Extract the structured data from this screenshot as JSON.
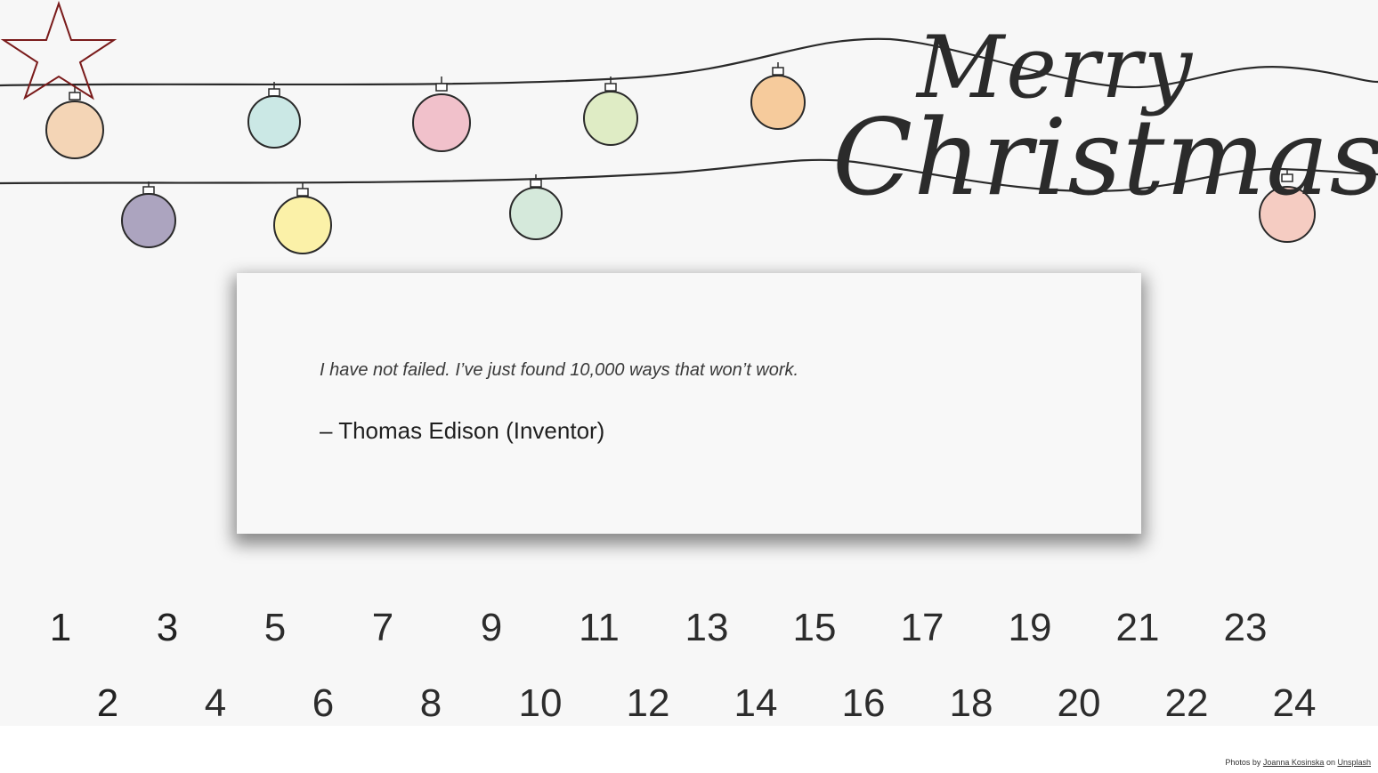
{
  "banner": {
    "greeting_line1": "Merry",
    "greeting_line2": "Christmas"
  },
  "quote": {
    "text": "I have not failed. I’ve just found 10,000 ways that won’t work.",
    "author": "– Thomas Edison (Inventor)"
  },
  "calendar": {
    "odd_days": [
      "1",
      "3",
      "5",
      "7",
      "9",
      "11",
      "13",
      "15",
      "17",
      "19",
      "21",
      "23"
    ],
    "even_days": [
      "2",
      "4",
      "6",
      "8",
      "10",
      "12",
      "14",
      "16",
      "18",
      "20",
      "22",
      "24"
    ],
    "highlighted_day": "3",
    "highlight_icon": "star-icon",
    "highlight_color": "#7a1b1b"
  },
  "credit": {
    "prefix": "Photos by",
    "author": "Joanna Kosinska",
    "middle": "on",
    "site": "Unsplash"
  },
  "colors": {
    "ornament_peach": "#f3c9a0",
    "ornament_mint": "#bfe3e0",
    "ornament_pink": "#efb3bf",
    "ornament_lime": "#d8e8b8",
    "ornament_orange": "#f6c38c",
    "ornament_purple": "#8b80a6",
    "ornament_yellow": "#fbf09a",
    "ornament_green": "#cfe6d6",
    "ornament_salmon": "#f5c4b8"
  }
}
